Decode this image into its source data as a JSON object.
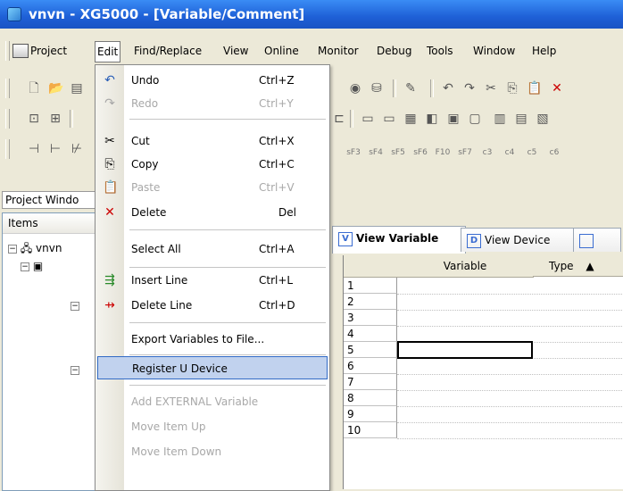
{
  "window": {
    "title": "vnvn - XG5000 - [Variable/Comment]",
    "app_icon": "xg5000-app-icon"
  },
  "menubar": {
    "items": [
      {
        "label": "Project"
      },
      {
        "label": "Edit"
      },
      {
        "label": "Find/Replace"
      },
      {
        "label": "View"
      },
      {
        "label": "Online"
      },
      {
        "label": "Monitor"
      },
      {
        "label": "Debug"
      },
      {
        "label": "Tools"
      },
      {
        "label": "Window"
      },
      {
        "label": "Help"
      }
    ]
  },
  "fkeys": [
    "sF3",
    "sF4",
    "sF5",
    "sF6",
    "F10",
    "sF7",
    "c3",
    "c4",
    "c5",
    "c6"
  ],
  "project_window": {
    "title": "Project Windo",
    "header": "Items",
    "root": "vnvn"
  },
  "tabs": [
    {
      "label": "View Variable",
      "icon": "V"
    },
    {
      "label": "View Device",
      "icon": "D"
    }
  ],
  "grid": {
    "columns": [
      "Variable",
      "Type"
    ],
    "rows": [
      "1",
      "2",
      "3",
      "4",
      "5",
      "6",
      "7",
      "8",
      "9",
      "10"
    ],
    "selected_row": "5"
  },
  "edit_menu": {
    "items": [
      {
        "label": "Undo",
        "shortcut": "Ctrl+Z",
        "disabled": false,
        "icon": "undo-icon"
      },
      {
        "label": "Redo",
        "shortcut": "Ctrl+Y",
        "disabled": true,
        "icon": "redo-icon"
      },
      {
        "label": "Cut",
        "shortcut": "Ctrl+X",
        "disabled": false,
        "icon": "scissors-icon"
      },
      {
        "label": "Copy",
        "shortcut": "Ctrl+C",
        "disabled": false,
        "icon": "copy-icon"
      },
      {
        "label": "Paste",
        "shortcut": "Ctrl+V",
        "disabled": true,
        "icon": "paste-icon"
      },
      {
        "label": "Delete",
        "shortcut": "Del",
        "disabled": false,
        "icon": "delete-x-icon"
      },
      {
        "label": "Select All",
        "shortcut": "Ctrl+A",
        "disabled": false
      },
      {
        "label": "Insert Line",
        "shortcut": "Ctrl+L",
        "disabled": false,
        "icon": "insert-line-icon"
      },
      {
        "label": "Delete Line",
        "shortcut": "Ctrl+D",
        "disabled": false,
        "icon": "delete-line-icon"
      },
      {
        "label": "Export Variables to File...",
        "shortcut": "",
        "disabled": false
      },
      {
        "label": "Register U Device",
        "shortcut": "",
        "disabled": false,
        "highlighted": true
      },
      {
        "label": "Add EXTERNAL Variable",
        "shortcut": "",
        "disabled": true
      },
      {
        "label": "Move Item Up",
        "shortcut": "",
        "disabled": true
      },
      {
        "label": "Move Item Down",
        "shortcut": "",
        "disabled": true
      }
    ]
  },
  "colors": {
    "title_bar": "#1e5fd6",
    "menu_highlight": "#c1d2ee",
    "menu_highlight_border": "#316ac5"
  }
}
